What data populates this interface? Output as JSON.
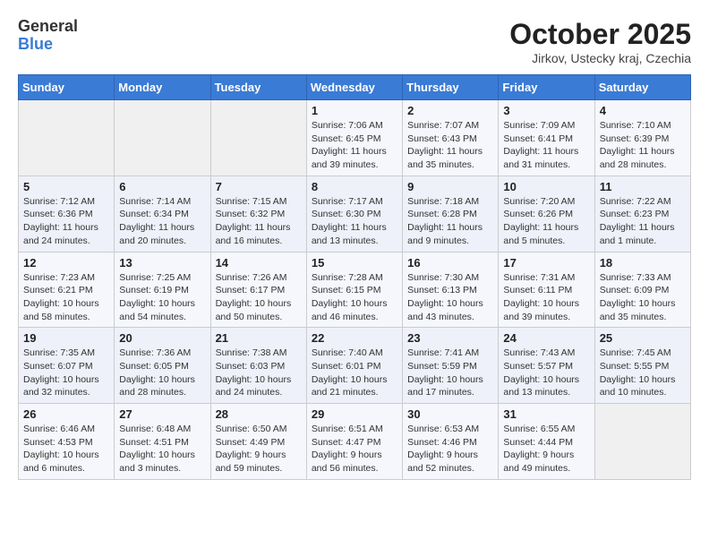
{
  "header": {
    "logo_general": "General",
    "logo_blue": "Blue",
    "title": "October 2025",
    "subtitle": "Jirkov, Ustecky kraj, Czechia"
  },
  "weekdays": [
    "Sunday",
    "Monday",
    "Tuesday",
    "Wednesday",
    "Thursday",
    "Friday",
    "Saturday"
  ],
  "weeks": [
    [
      {
        "day": "",
        "info": ""
      },
      {
        "day": "",
        "info": ""
      },
      {
        "day": "",
        "info": ""
      },
      {
        "day": "1",
        "info": "Sunrise: 7:06 AM\nSunset: 6:45 PM\nDaylight: 11 hours\nand 39 minutes."
      },
      {
        "day": "2",
        "info": "Sunrise: 7:07 AM\nSunset: 6:43 PM\nDaylight: 11 hours\nand 35 minutes."
      },
      {
        "day": "3",
        "info": "Sunrise: 7:09 AM\nSunset: 6:41 PM\nDaylight: 11 hours\nand 31 minutes."
      },
      {
        "day": "4",
        "info": "Sunrise: 7:10 AM\nSunset: 6:39 PM\nDaylight: 11 hours\nand 28 minutes."
      }
    ],
    [
      {
        "day": "5",
        "info": "Sunrise: 7:12 AM\nSunset: 6:36 PM\nDaylight: 11 hours\nand 24 minutes."
      },
      {
        "day": "6",
        "info": "Sunrise: 7:14 AM\nSunset: 6:34 PM\nDaylight: 11 hours\nand 20 minutes."
      },
      {
        "day": "7",
        "info": "Sunrise: 7:15 AM\nSunset: 6:32 PM\nDaylight: 11 hours\nand 16 minutes."
      },
      {
        "day": "8",
        "info": "Sunrise: 7:17 AM\nSunset: 6:30 PM\nDaylight: 11 hours\nand 13 minutes."
      },
      {
        "day": "9",
        "info": "Sunrise: 7:18 AM\nSunset: 6:28 PM\nDaylight: 11 hours\nand 9 minutes."
      },
      {
        "day": "10",
        "info": "Sunrise: 7:20 AM\nSunset: 6:26 PM\nDaylight: 11 hours\nand 5 minutes."
      },
      {
        "day": "11",
        "info": "Sunrise: 7:22 AM\nSunset: 6:23 PM\nDaylight: 11 hours\nand 1 minute."
      }
    ],
    [
      {
        "day": "12",
        "info": "Sunrise: 7:23 AM\nSunset: 6:21 PM\nDaylight: 10 hours\nand 58 minutes."
      },
      {
        "day": "13",
        "info": "Sunrise: 7:25 AM\nSunset: 6:19 PM\nDaylight: 10 hours\nand 54 minutes."
      },
      {
        "day": "14",
        "info": "Sunrise: 7:26 AM\nSunset: 6:17 PM\nDaylight: 10 hours\nand 50 minutes."
      },
      {
        "day": "15",
        "info": "Sunrise: 7:28 AM\nSunset: 6:15 PM\nDaylight: 10 hours\nand 46 minutes."
      },
      {
        "day": "16",
        "info": "Sunrise: 7:30 AM\nSunset: 6:13 PM\nDaylight: 10 hours\nand 43 minutes."
      },
      {
        "day": "17",
        "info": "Sunrise: 7:31 AM\nSunset: 6:11 PM\nDaylight: 10 hours\nand 39 minutes."
      },
      {
        "day": "18",
        "info": "Sunrise: 7:33 AM\nSunset: 6:09 PM\nDaylight: 10 hours\nand 35 minutes."
      }
    ],
    [
      {
        "day": "19",
        "info": "Sunrise: 7:35 AM\nSunset: 6:07 PM\nDaylight: 10 hours\nand 32 minutes."
      },
      {
        "day": "20",
        "info": "Sunrise: 7:36 AM\nSunset: 6:05 PM\nDaylight: 10 hours\nand 28 minutes."
      },
      {
        "day": "21",
        "info": "Sunrise: 7:38 AM\nSunset: 6:03 PM\nDaylight: 10 hours\nand 24 minutes."
      },
      {
        "day": "22",
        "info": "Sunrise: 7:40 AM\nSunset: 6:01 PM\nDaylight: 10 hours\nand 21 minutes."
      },
      {
        "day": "23",
        "info": "Sunrise: 7:41 AM\nSunset: 5:59 PM\nDaylight: 10 hours\nand 17 minutes."
      },
      {
        "day": "24",
        "info": "Sunrise: 7:43 AM\nSunset: 5:57 PM\nDaylight: 10 hours\nand 13 minutes."
      },
      {
        "day": "25",
        "info": "Sunrise: 7:45 AM\nSunset: 5:55 PM\nDaylight: 10 hours\nand 10 minutes."
      }
    ],
    [
      {
        "day": "26",
        "info": "Sunrise: 6:46 AM\nSunset: 4:53 PM\nDaylight: 10 hours\nand 6 minutes."
      },
      {
        "day": "27",
        "info": "Sunrise: 6:48 AM\nSunset: 4:51 PM\nDaylight: 10 hours\nand 3 minutes."
      },
      {
        "day": "28",
        "info": "Sunrise: 6:50 AM\nSunset: 4:49 PM\nDaylight: 9 hours\nand 59 minutes."
      },
      {
        "day": "29",
        "info": "Sunrise: 6:51 AM\nSunset: 4:47 PM\nDaylight: 9 hours\nand 56 minutes."
      },
      {
        "day": "30",
        "info": "Sunrise: 6:53 AM\nSunset: 4:46 PM\nDaylight: 9 hours\nand 52 minutes."
      },
      {
        "day": "31",
        "info": "Sunrise: 6:55 AM\nSunset: 4:44 PM\nDaylight: 9 hours\nand 49 minutes."
      },
      {
        "day": "",
        "info": ""
      }
    ]
  ]
}
